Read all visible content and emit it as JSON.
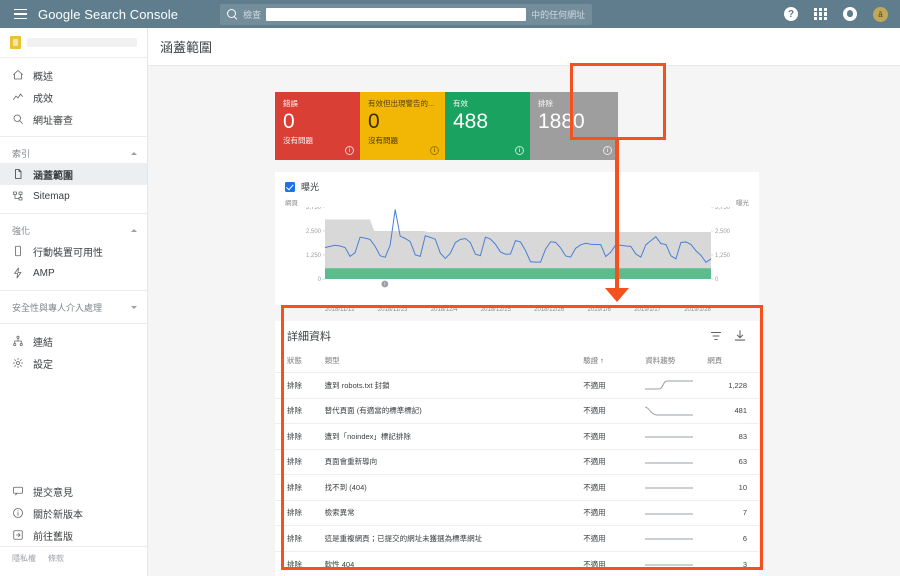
{
  "topbar": {
    "brand": "Google Search Console",
    "menu_icon": "hamburger-icon",
    "search": {
      "icon": "search-icon",
      "prefix": "檢查",
      "value": "",
      "suffix": "中的任何網址"
    },
    "help_label": "?",
    "avatar_label": "ā"
  },
  "sidebar": {
    "property_placeholder": "",
    "items": [
      {
        "label": "概述",
        "icon": "home-icon",
        "active": false
      },
      {
        "label": "成效",
        "icon": "chart-line-icon",
        "active": false
      },
      {
        "label": "網址審查",
        "icon": "search-icon",
        "active": false
      }
    ],
    "groups": [
      {
        "label": "索引",
        "expanded": true,
        "items": [
          {
            "label": "涵蓋範圍",
            "icon": "document-icon",
            "active": true
          },
          {
            "label": "Sitemap",
            "icon": "sitemap-icon",
            "active": false
          }
        ]
      },
      {
        "label": "強化",
        "expanded": true,
        "items": [
          {
            "label": "行動裝置可用性",
            "icon": "mobile-icon",
            "active": false
          },
          {
            "label": "AMP",
            "icon": "bolt-icon",
            "active": false
          }
        ]
      },
      {
        "label": "安全性與專人介入處理",
        "expanded": false,
        "items": []
      }
    ],
    "items_after": [
      {
        "label": "連結",
        "icon": "links-icon",
        "active": false
      },
      {
        "label": "設定",
        "icon": "gear-icon",
        "active": false
      }
    ],
    "bottom_items": [
      {
        "label": "提交意見",
        "icon": "feedback-icon"
      },
      {
        "label": "關於新版本",
        "icon": "info-icon"
      },
      {
        "label": "前往舊版",
        "icon": "exit-icon"
      }
    ],
    "footer": {
      "privacy": "隱私權",
      "terms": "條款"
    }
  },
  "page": {
    "title": "涵蓋範圍"
  },
  "cards": [
    {
      "label": "錯誤",
      "value": "0",
      "sub": "沒有問題",
      "color": "#d93f35",
      "info": "i"
    },
    {
      "label": "有效但出現警告的...",
      "value": "0",
      "sub": "沒有問題",
      "color": "#f2b705",
      "info": "i"
    },
    {
      "label": "有效",
      "value": "488",
      "sub": "",
      "color": "#1aa260",
      "info": "i"
    },
    {
      "label": "排除",
      "value": "1880",
      "sub": "",
      "color": "#9e9e9e",
      "info": "i"
    }
  ],
  "chart_panel": {
    "legend_checkbox_label": "曝光",
    "legend_checked": true
  },
  "chart_data": {
    "type": "area",
    "title": "",
    "ylabel": "網頁",
    "y2label": "曝光",
    "ylim": [
      0,
      3750
    ],
    "yticks": [
      "0",
      "1,250",
      "2,500",
      "3,750"
    ],
    "y2ticks": [
      "0",
      "1,250",
      "2,500",
      "3,750"
    ],
    "grid": false,
    "xlabel": "",
    "tick_labels": [
      "2018/11/12",
      "2018/11/23",
      "2018/12/4",
      "2018/12/15",
      "2018/12/26",
      "2019/1/6",
      "2019/1/17",
      "2019/1/28"
    ],
    "series": [
      {
        "name": "排除",
        "type": "area",
        "color": "#d8d8d8",
        "values": [
          3100,
          3100,
          3100,
          3100,
          3100,
          3100,
          3100,
          3100,
          3100,
          3100,
          3100,
          2500,
          2500,
          2500,
          2500,
          2500,
          2500,
          2500,
          2500,
          2500,
          2500,
          2500,
          2500,
          2450,
          2450,
          2450,
          2450,
          2450,
          2450,
          2450,
          2450,
          2450,
          2450,
          2450,
          2450,
          2450,
          2450,
          2450,
          2450,
          2450,
          2450,
          2450,
          2450,
          2450,
          2450,
          2450,
          2450,
          2450,
          2450,
          2450,
          2450,
          2450,
          2450,
          2450,
          2450,
          2450,
          2450,
          2450,
          2450,
          2450,
          2450,
          2450,
          2450,
          2450,
          2450,
          2450,
          2450,
          2450,
          2450,
          2450,
          2450,
          2450,
          2450,
          2450,
          2450,
          2450,
          2450,
          2450,
          2450,
          2450,
          2450,
          2450,
          2450,
          2450,
          2450,
          2450,
          2450
        ]
      },
      {
        "name": "有效",
        "type": "area",
        "color": "#5bbd8c",
        "values": [
          560,
          560,
          560,
          560,
          560,
          560,
          560,
          560,
          560,
          560,
          560,
          560,
          560,
          560,
          560,
          560,
          560,
          560,
          560,
          560,
          560,
          560,
          560,
          560,
          560,
          560,
          560,
          560,
          560,
          560,
          560,
          560,
          560,
          560,
          560,
          560,
          560,
          560,
          560,
          560,
          560,
          560,
          560,
          560,
          560,
          560,
          560,
          560,
          560,
          560,
          560,
          560,
          560,
          560,
          560,
          560,
          560,
          560,
          560,
          560,
          560,
          560,
          560,
          560,
          560,
          560,
          560,
          560,
          560,
          560,
          560,
          560,
          560,
          560,
          560,
          560,
          560,
          560,
          560,
          560,
          560,
          560,
          560,
          560,
          560,
          560,
          560
        ]
      },
      {
        "name": "曝光",
        "type": "line",
        "color": "#4a7fd4",
        "values": [
          1640,
          1700,
          1760,
          1720,
          1640,
          1180,
          1370,
          2180,
          2130,
          2060,
          1700,
          1210,
          1130,
          1770,
          3620,
          2230,
          2110,
          1950,
          1260,
          1180,
          2250,
          2170,
          2070,
          1350,
          1070,
          1340,
          1900,
          2060,
          2110,
          1900,
          1290,
          1220,
          2180,
          2080,
          1810,
          1410,
          1290,
          1300,
          2000,
          1930,
          1480,
          900,
          880,
          880,
          1560,
          1940,
          1910,
          1620,
          1200,
          1140,
          1600,
          1780,
          1860,
          1810,
          1800,
          1790,
          1170,
          1400,
          1780,
          1760,
          1720,
          1700,
          1300,
          1140,
          1780,
          1990,
          2200,
          1840,
          1800,
          1210,
          1050,
          1900,
          1930,
          1800,
          1470,
          1230,
          870,
          1050
        ]
      }
    ]
  },
  "details": {
    "title": "詳細資料",
    "filter_icon": "filter-icon",
    "download_icon": "download-icon",
    "columns": [
      "狀態",
      "類型",
      "驗證",
      "資料趨勢",
      "網頁"
    ],
    "sort_column": "驗證",
    "sort_arrow": "↑",
    "rows": [
      {
        "status": "排除",
        "type": "遭到 robots.txt 封鎖",
        "validation": "不適用",
        "trend": "step-up",
        "pages": "1,228"
      },
      {
        "status": "排除",
        "type": "替代頁面 (有適當的標準標記)",
        "validation": "不適用",
        "trend": "step-down",
        "pages": "481"
      },
      {
        "status": "排除",
        "type": "遭到「noindex」標記排除",
        "validation": "不適用",
        "trend": "flat",
        "pages": "83"
      },
      {
        "status": "排除",
        "type": "頁面會重新導向",
        "validation": "不適用",
        "trend": "flat",
        "pages": "63"
      },
      {
        "status": "排除",
        "type": "找不到 (404)",
        "validation": "不適用",
        "trend": "flat",
        "pages": "10"
      },
      {
        "status": "排除",
        "type": "檢索異常",
        "validation": "不適用",
        "trend": "flat",
        "pages": "7"
      },
      {
        "status": "排除",
        "type": "這是重複網頁；已提交的網址未獲選為標準網址",
        "validation": "不適用",
        "trend": "flat",
        "pages": "6"
      },
      {
        "status": "排除",
        "type": "軟性 404",
        "validation": "不適用",
        "trend": "flat",
        "pages": "3"
      }
    ]
  },
  "annotations": {
    "highlight_card": "排除",
    "arrow_color": "#f4511e",
    "highlight_table": "詳細資料"
  }
}
